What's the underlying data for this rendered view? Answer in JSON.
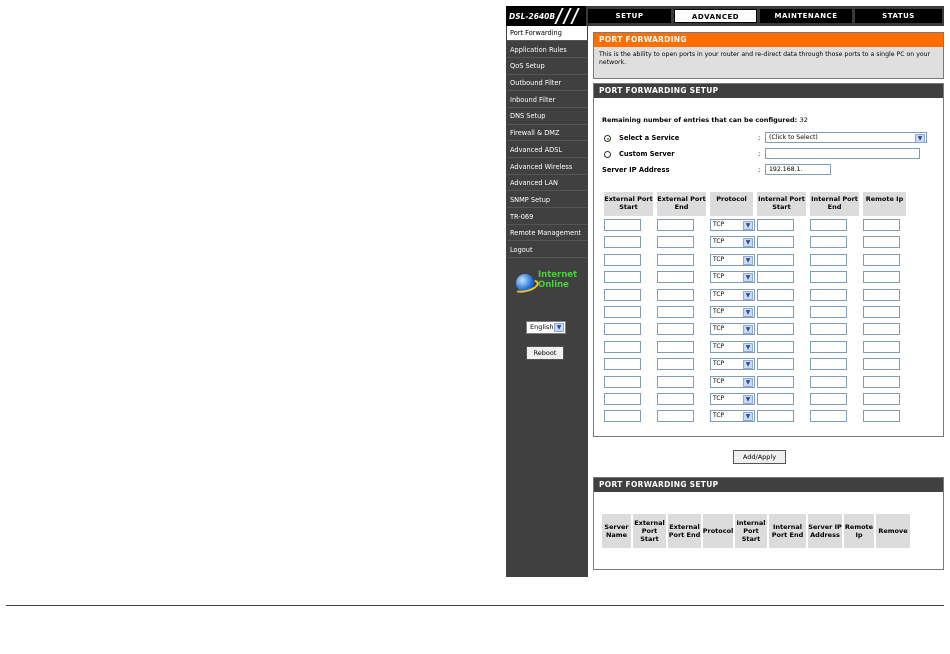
{
  "header": {
    "model": "DSL-2640B",
    "tabs": [
      {
        "label": "SETUP",
        "active": false
      },
      {
        "label": "ADVANCED",
        "active": true
      },
      {
        "label": "MAINTENANCE",
        "active": false
      },
      {
        "label": "STATUS",
        "active": false
      }
    ]
  },
  "sidebar": {
    "items": [
      {
        "label": "Port Forwarding",
        "active": true
      },
      {
        "label": "Application Rules",
        "active": false
      },
      {
        "label": "QoS Setup",
        "active": false
      },
      {
        "label": "Outbound Filter",
        "active": false
      },
      {
        "label": "Inbound Filter",
        "active": false
      },
      {
        "label": "DNS Setup",
        "active": false
      },
      {
        "label": "Firewall & DMZ",
        "active": false
      },
      {
        "label": "Advanced ADSL",
        "active": false
      },
      {
        "label": "Advanced Wireless",
        "active": false
      },
      {
        "label": "Advanced LAN",
        "active": false
      },
      {
        "label": "SNMP Setup",
        "active": false
      },
      {
        "label": "TR-069",
        "active": false
      },
      {
        "label": "Remote Management",
        "active": false
      },
      {
        "label": "Logout",
        "active": false
      }
    ],
    "status_line1": "Internet",
    "status_line2": "Online",
    "language": "English",
    "reboot_label": "Reboot"
  },
  "intro": {
    "title": "PORT FORWARDING",
    "text": "This is the ability to open ports in your router and re-direct data through those ports to a single PC on your network."
  },
  "setup": {
    "title": "PORT FORWARDING SETUP",
    "remaining_label": "Remaining number of entries that can be configured:",
    "remaining_value": "32",
    "select_service_label": "Select a Service",
    "custom_server_label": "Custom Server",
    "server_ip_label": "Server IP Address",
    "service_value": "(Click to Select)",
    "server_ip_value": "192.168.1.",
    "colon": ":",
    "columns": [
      "External Port Start",
      "External Port End",
      "Protocol",
      "Internal Port Start",
      "Internal Port End",
      "Remote Ip"
    ],
    "rows": [
      "TCP",
      "TCP",
      "TCP",
      "TCP",
      "TCP",
      "TCP",
      "TCP",
      "TCP",
      "TCP",
      "TCP",
      "TCP",
      "TCP"
    ]
  },
  "add_apply_label": "Add/Apply",
  "list": {
    "title": "PORT FORWARDING SETUP",
    "columns": [
      "Server Name",
      "External Port Start",
      "External Port End",
      "Protocol",
      "Internal Port Start",
      "Internal Port End",
      "Server IP Address",
      "Remote Ip",
      "Remove"
    ]
  }
}
